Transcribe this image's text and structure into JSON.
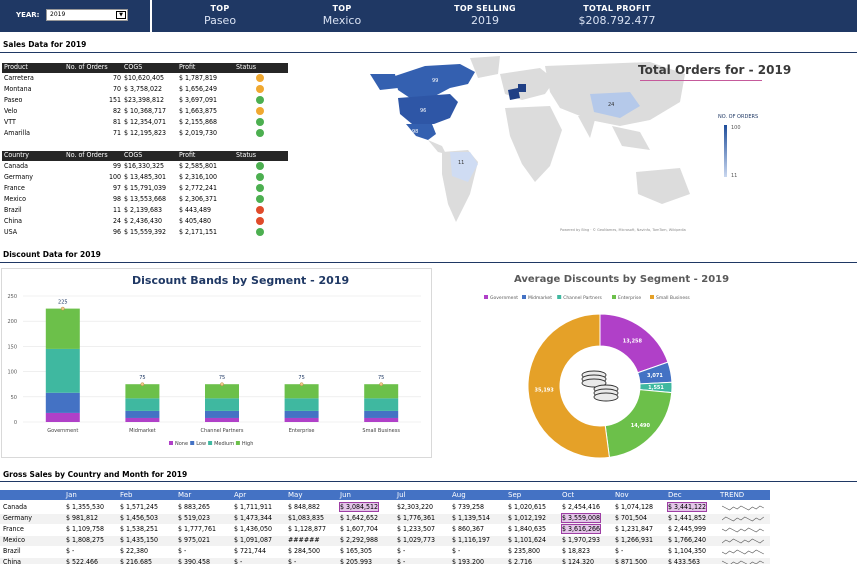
{
  "banner": {
    "year_label": "YEAR:",
    "year_value": "2019",
    "kpis": [
      {
        "title": "TOP",
        "value": "Paseo"
      },
      {
        "title": "TOP",
        "value": "Mexico"
      },
      {
        "title": "TOP SELLING",
        "value": "2019"
      },
      {
        "title": "TOTAL PROFIT",
        "value": "$208.792.477"
      }
    ]
  },
  "sales": {
    "title": "Sales Data for 2019",
    "product_headers": [
      "Product",
      "No. of Orders",
      "COGS",
      "Profit",
      "Status"
    ],
    "products": [
      {
        "name": "Carretera",
        "orders": "70",
        "cogs": "$10,620,405",
        "profit": "$ 1,787,819",
        "status": "mid"
      },
      {
        "name": "Montana",
        "orders": "70",
        "cogs": "$ 3,758,022",
        "profit": "$ 1,656,249",
        "status": "mid"
      },
      {
        "name": "Paseo",
        "orders": "151",
        "cogs": "$23,398,812",
        "profit": "$ 3,697,091",
        "status": "good"
      },
      {
        "name": "Velo",
        "orders": "82",
        "cogs": "$ 10,368,717",
        "profit": "$ 1,663,875",
        "status": "mid"
      },
      {
        "name": "VTT",
        "orders": "81",
        "cogs": "$ 12,354,071",
        "profit": "$ 2,155,868",
        "status": "good"
      },
      {
        "name": "Amarilla",
        "orders": "71",
        "cogs": "$ 12,195,823",
        "profit": "$ 2,019,730",
        "status": "good"
      }
    ],
    "country_headers": [
      "Country",
      "No. of Orders",
      "COGS",
      "Profit",
      "Status"
    ],
    "countries": [
      {
        "name": "Canada",
        "orders": "99",
        "cogs": "$16,330,325",
        "profit": "$ 2,585,801",
        "status": "good"
      },
      {
        "name": "Germany",
        "orders": "100",
        "cogs": "$ 13,485,301",
        "profit": "$ 2,316,100",
        "status": "good"
      },
      {
        "name": "France",
        "orders": "97",
        "cogs": "$ 15,791,039",
        "profit": "$ 2,772,241",
        "status": "good"
      },
      {
        "name": "Mexico",
        "orders": "98",
        "cogs": "$ 13,553,668",
        "profit": "$ 2,306,371",
        "status": "good"
      },
      {
        "name": "Brazil",
        "orders": "11",
        "cogs": "$ 2,139,683",
        "profit": "$ 443,489",
        "status": "bad"
      },
      {
        "name": "China",
        "orders": "24",
        "cogs": "$ 2,436,430",
        "profit": "$ 405,480",
        "status": "bad"
      },
      {
        "name": "USA",
        "orders": "96",
        "cogs": "$ 15,559,392",
        "profit": "$ 2,171,151",
        "status": "good"
      }
    ]
  },
  "map": {
    "title": "Total Orders for - 2019",
    "legend_title": "NO. OF ORDERS",
    "legend_high": "100",
    "legend_low": "11",
    "labels": [
      {
        "text": "96"
      },
      {
        "text": "98"
      },
      {
        "text": "99"
      },
      {
        "text": "24"
      },
      {
        "text": "11"
      }
    ],
    "credit": "Powered by Bing · © GeoNames, Microsoft, Navinfo, TomTom, Wikipedia"
  },
  "discount": {
    "title": "Discount Data for 2019"
  },
  "chart_data": [
    {
      "type": "bar",
      "title": "Discount Bands by Segment - 2019",
      "categories": [
        "Government",
        "Midmarket",
        "Channel Partners",
        "Enterprise",
        "Small Business"
      ],
      "totals": [
        225,
        75,
        75,
        75,
        75
      ],
      "series": [
        {
          "name": "None",
          "values": [
            18,
            8,
            8,
            8,
            8
          ]
        },
        {
          "name": "Low",
          "values": [
            40,
            14,
            14,
            14,
            14
          ]
        },
        {
          "name": "Medium",
          "values": [
            87,
            25,
            25,
            25,
            25
          ]
        },
        {
          "name": "High",
          "values": [
            80,
            28,
            28,
            28,
            28
          ]
        }
      ],
      "ylim": [
        0,
        250
      ],
      "yticks": [
        0,
        50,
        100,
        150,
        200,
        250
      ],
      "colors": [
        "#b040c8",
        "#4472c4",
        "#3fb8a0",
        "#6cc04a"
      ]
    },
    {
      "type": "pie",
      "title": "Average Discounts by Segment - 2019",
      "labels": [
        "Government",
        "Midmarket",
        "Channel Partners",
        "Enterprise",
        "Small Business"
      ],
      "values": [
        13258,
        3071,
        1551,
        14490,
        35193
      ],
      "display": [
        "13,258",
        "3,071",
        "1,551",
        "14,490",
        "35,193"
      ],
      "colors": [
        "#b040c8",
        "#4472c4",
        "#3fb8a0",
        "#6cc04a",
        "#e5a128"
      ]
    }
  ],
  "gross": {
    "title": "Gross Sales by Country and Month for 2019",
    "headers": [
      "Jan",
      "Feb",
      "Mar",
      "Apr",
      "May",
      "Jun",
      "Jul",
      "Aug",
      "Sep",
      "Oct",
      "Nov",
      "Dec",
      "TREND"
    ],
    "rows": [
      {
        "country": "Canada",
        "cells": [
          "$ 1,355,530",
          "$ 1,571,245",
          "$ 883,265",
          "$ 1,711,911",
          "$ 848,882",
          "$ 3,084,512",
          "$2,303,220",
          "$ 739,258",
          "$ 1,020,615",
          "$ 2,454,416",
          "$ 1,074,128",
          "$ 3,441,122"
        ]
      },
      {
        "country": "Germany",
        "cells": [
          "$ 981,812",
          "$ 1,456,503",
          "$ 519,023",
          "$ 1,473,344",
          "$1,083,835",
          "$ 1,642,652",
          "$ 1,776,361",
          "$ 1,139,514",
          "$ 1,012,192",
          "$ 3,559,008",
          "$ 701,504",
          "$ 1,441,852"
        ]
      },
      {
        "country": "France",
        "cells": [
          "$ 1,109,758",
          "$ 1,538,251",
          "$ 1,777,761",
          "$ 1,436,050",
          "$ 1,128,877",
          "$ 1,607,704",
          "$ 1,233,507",
          "$ 860,367",
          "$ 1,840,635",
          "$ 3,616,266",
          "$ 1,231,847",
          "$ 2,445,999"
        ]
      },
      {
        "country": "Mexico",
        "cells": [
          "$ 1,808,275",
          "$ 1,435,150",
          "$ 975,021",
          "$ 1,091,087",
          "######",
          "$ 2,292,988",
          "$ 1,029,773",
          "$ 1,116,197",
          "$ 1,101,624",
          "$ 1,970,293",
          "$ 1,266,931",
          "$ 1,766,240"
        ]
      },
      {
        "country": "Brazil",
        "cells": [
          "$ -",
          "$ 22,380",
          "$ -",
          "$ 721,744",
          "$ 284,500",
          "$ 165,305",
          "$ -",
          "$ -",
          "$ 235,800",
          "$ 18,823",
          "$ -",
          "$ 1,104,350"
        ]
      },
      {
        "country": "China",
        "cells": [
          "$ 522,466",
          "$ 216,685",
          "$ 390,458",
          "$ -",
          "$ -",
          "$ 205,993",
          "$ -",
          "$ 193,200",
          "$ 2,716",
          "$ 124,320",
          "$ 871,500",
          "$ 433,563"
        ]
      }
    ]
  }
}
